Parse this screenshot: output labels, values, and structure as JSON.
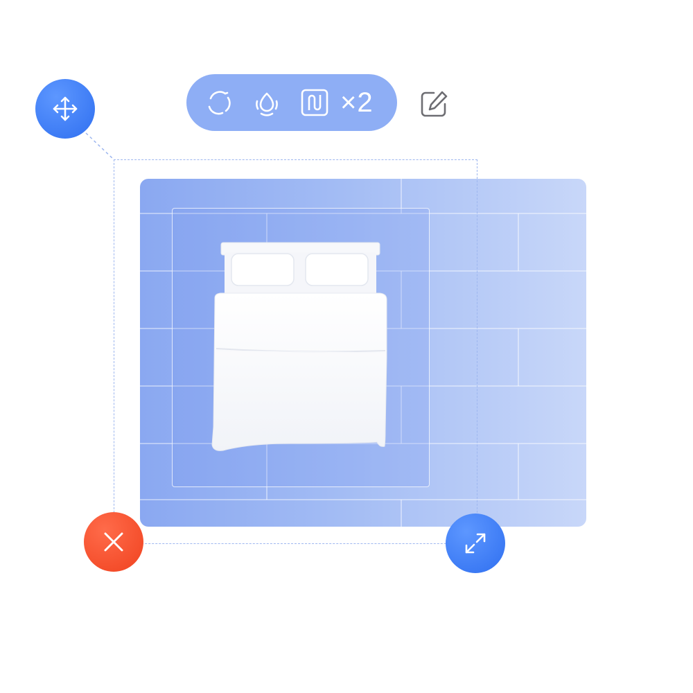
{
  "toolbar": {
    "tools": [
      {
        "name": "rotate",
        "icon": "rotate-icon"
      },
      {
        "name": "material",
        "icon": "material-drop-icon"
      },
      {
        "name": "magnet",
        "icon": "magnet-icon"
      }
    ],
    "quantity_label": "×2",
    "edit_icon": "edit-icon"
  },
  "handles": {
    "move_icon": "move-arrows-icon",
    "delete_icon": "close-icon",
    "resize_icon": "resize-diagonal-icon"
  },
  "colors": {
    "accent_blue": "#2f6ff0",
    "danger_red": "#f0421f",
    "toolbar_bg": "#8eaef5",
    "floor": "#a3bcf4",
    "selection_dash": "#9db6ef"
  }
}
